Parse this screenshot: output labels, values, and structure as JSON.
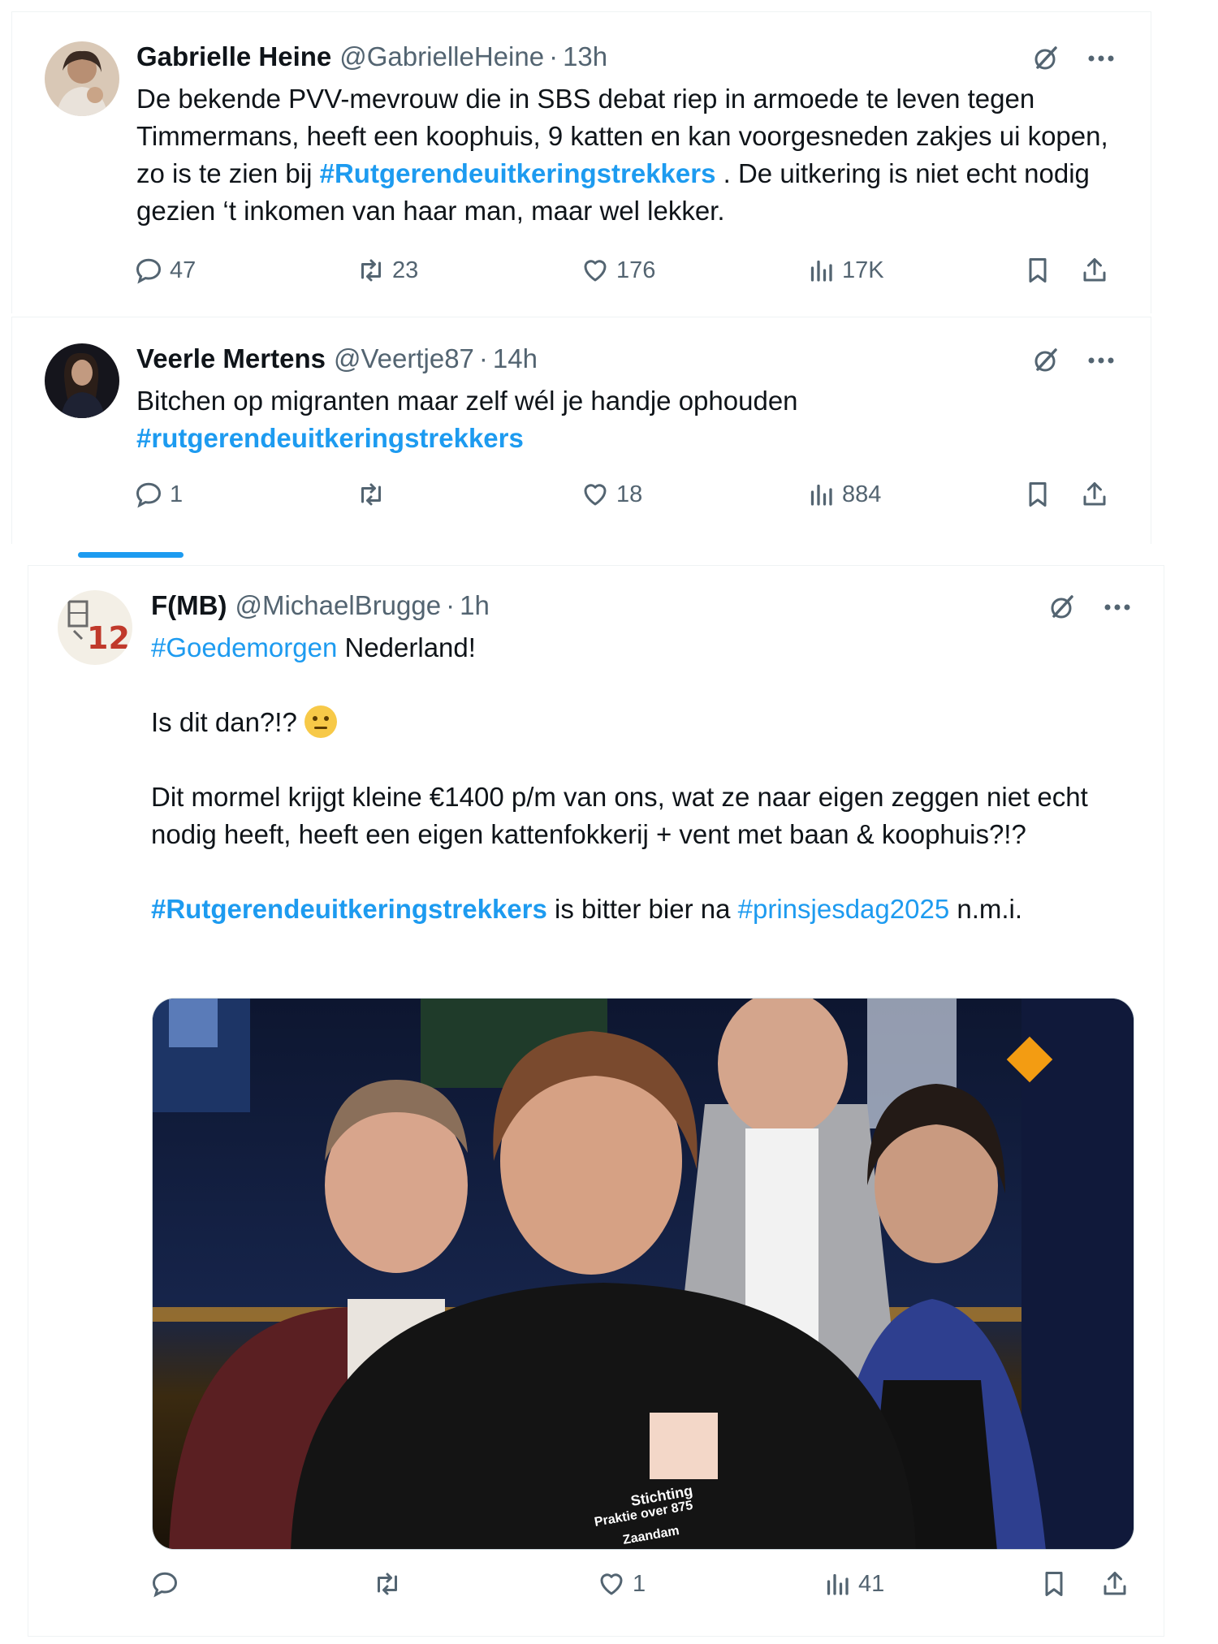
{
  "tweets": [
    {
      "name": "Gabrielle Heine",
      "handle": "@GabrielleHeine",
      "separator": "·",
      "time": "13h",
      "text_parts": {
        "p1": "De bekende PVV-mevrouw die in SBS debat riep in armoede te leven tegen Timmermans, heeft een koophuis, 9 katten en kan voorgesneden zakjes ui kopen, zo is te zien bij ",
        "tag1": "#Rutgerendeuitkeringstrekkers",
        "p2": " . De uitkering is niet echt nodig gezien ‘t inkomen van haar man, maar wel lekker."
      },
      "stats": {
        "replies": "47",
        "reposts": "23",
        "likes": "176",
        "views": "17K"
      }
    },
    {
      "name": "Veerle Mertens",
      "handle": "@Veertje87",
      "separator": "·",
      "time": "14h",
      "text_parts": {
        "p1": "Bitchen op migranten maar zelf wél je handje ophouden",
        "tag1": "#rutgerendeuitkeringstrekkers"
      },
      "stats": {
        "replies": "1",
        "reposts": "",
        "likes": "18",
        "views": "884"
      }
    },
    {
      "name": "F(MB)",
      "handle": "@MichaelBrugge",
      "separator": "·",
      "time": "1h",
      "text_parts": {
        "tag0": "#Goedemorgen",
        "p0": " Nederland!",
        "p1": "Is dit dan?!? ",
        "p2": "Dit mormel krijgt kleine €1400 p/m van ons, wat ze naar eigen zeggen niet echt nodig heeft, heeft een eigen kattenfokkerij + vent met baan & koophuis?!?",
        "tag1": "#Rutgerendeuitkeringstrekkers",
        "p3": " is bitter bier na ",
        "tag2": "#prinsjesdag2025",
        "p4": " n.m.i."
      },
      "media_caption": {
        "shirt_line1": "Stichting",
        "shirt_line2": "Praktie over 875",
        "shirt_line3": "Zaandam"
      },
      "stats": {
        "replies": "",
        "reposts": "",
        "likes": "1",
        "views": "41"
      }
    }
  ],
  "icons": {
    "reply": "reply-icon",
    "repost": "repost-icon",
    "like": "heart-icon",
    "views": "views-icon",
    "bookmark": "bookmark-icon",
    "share": "share-icon",
    "grok": "grok-icon",
    "more": "more-icon"
  },
  "colors": {
    "link": "#1d9bf0",
    "muted": "#536471",
    "text": "#0f1419"
  }
}
